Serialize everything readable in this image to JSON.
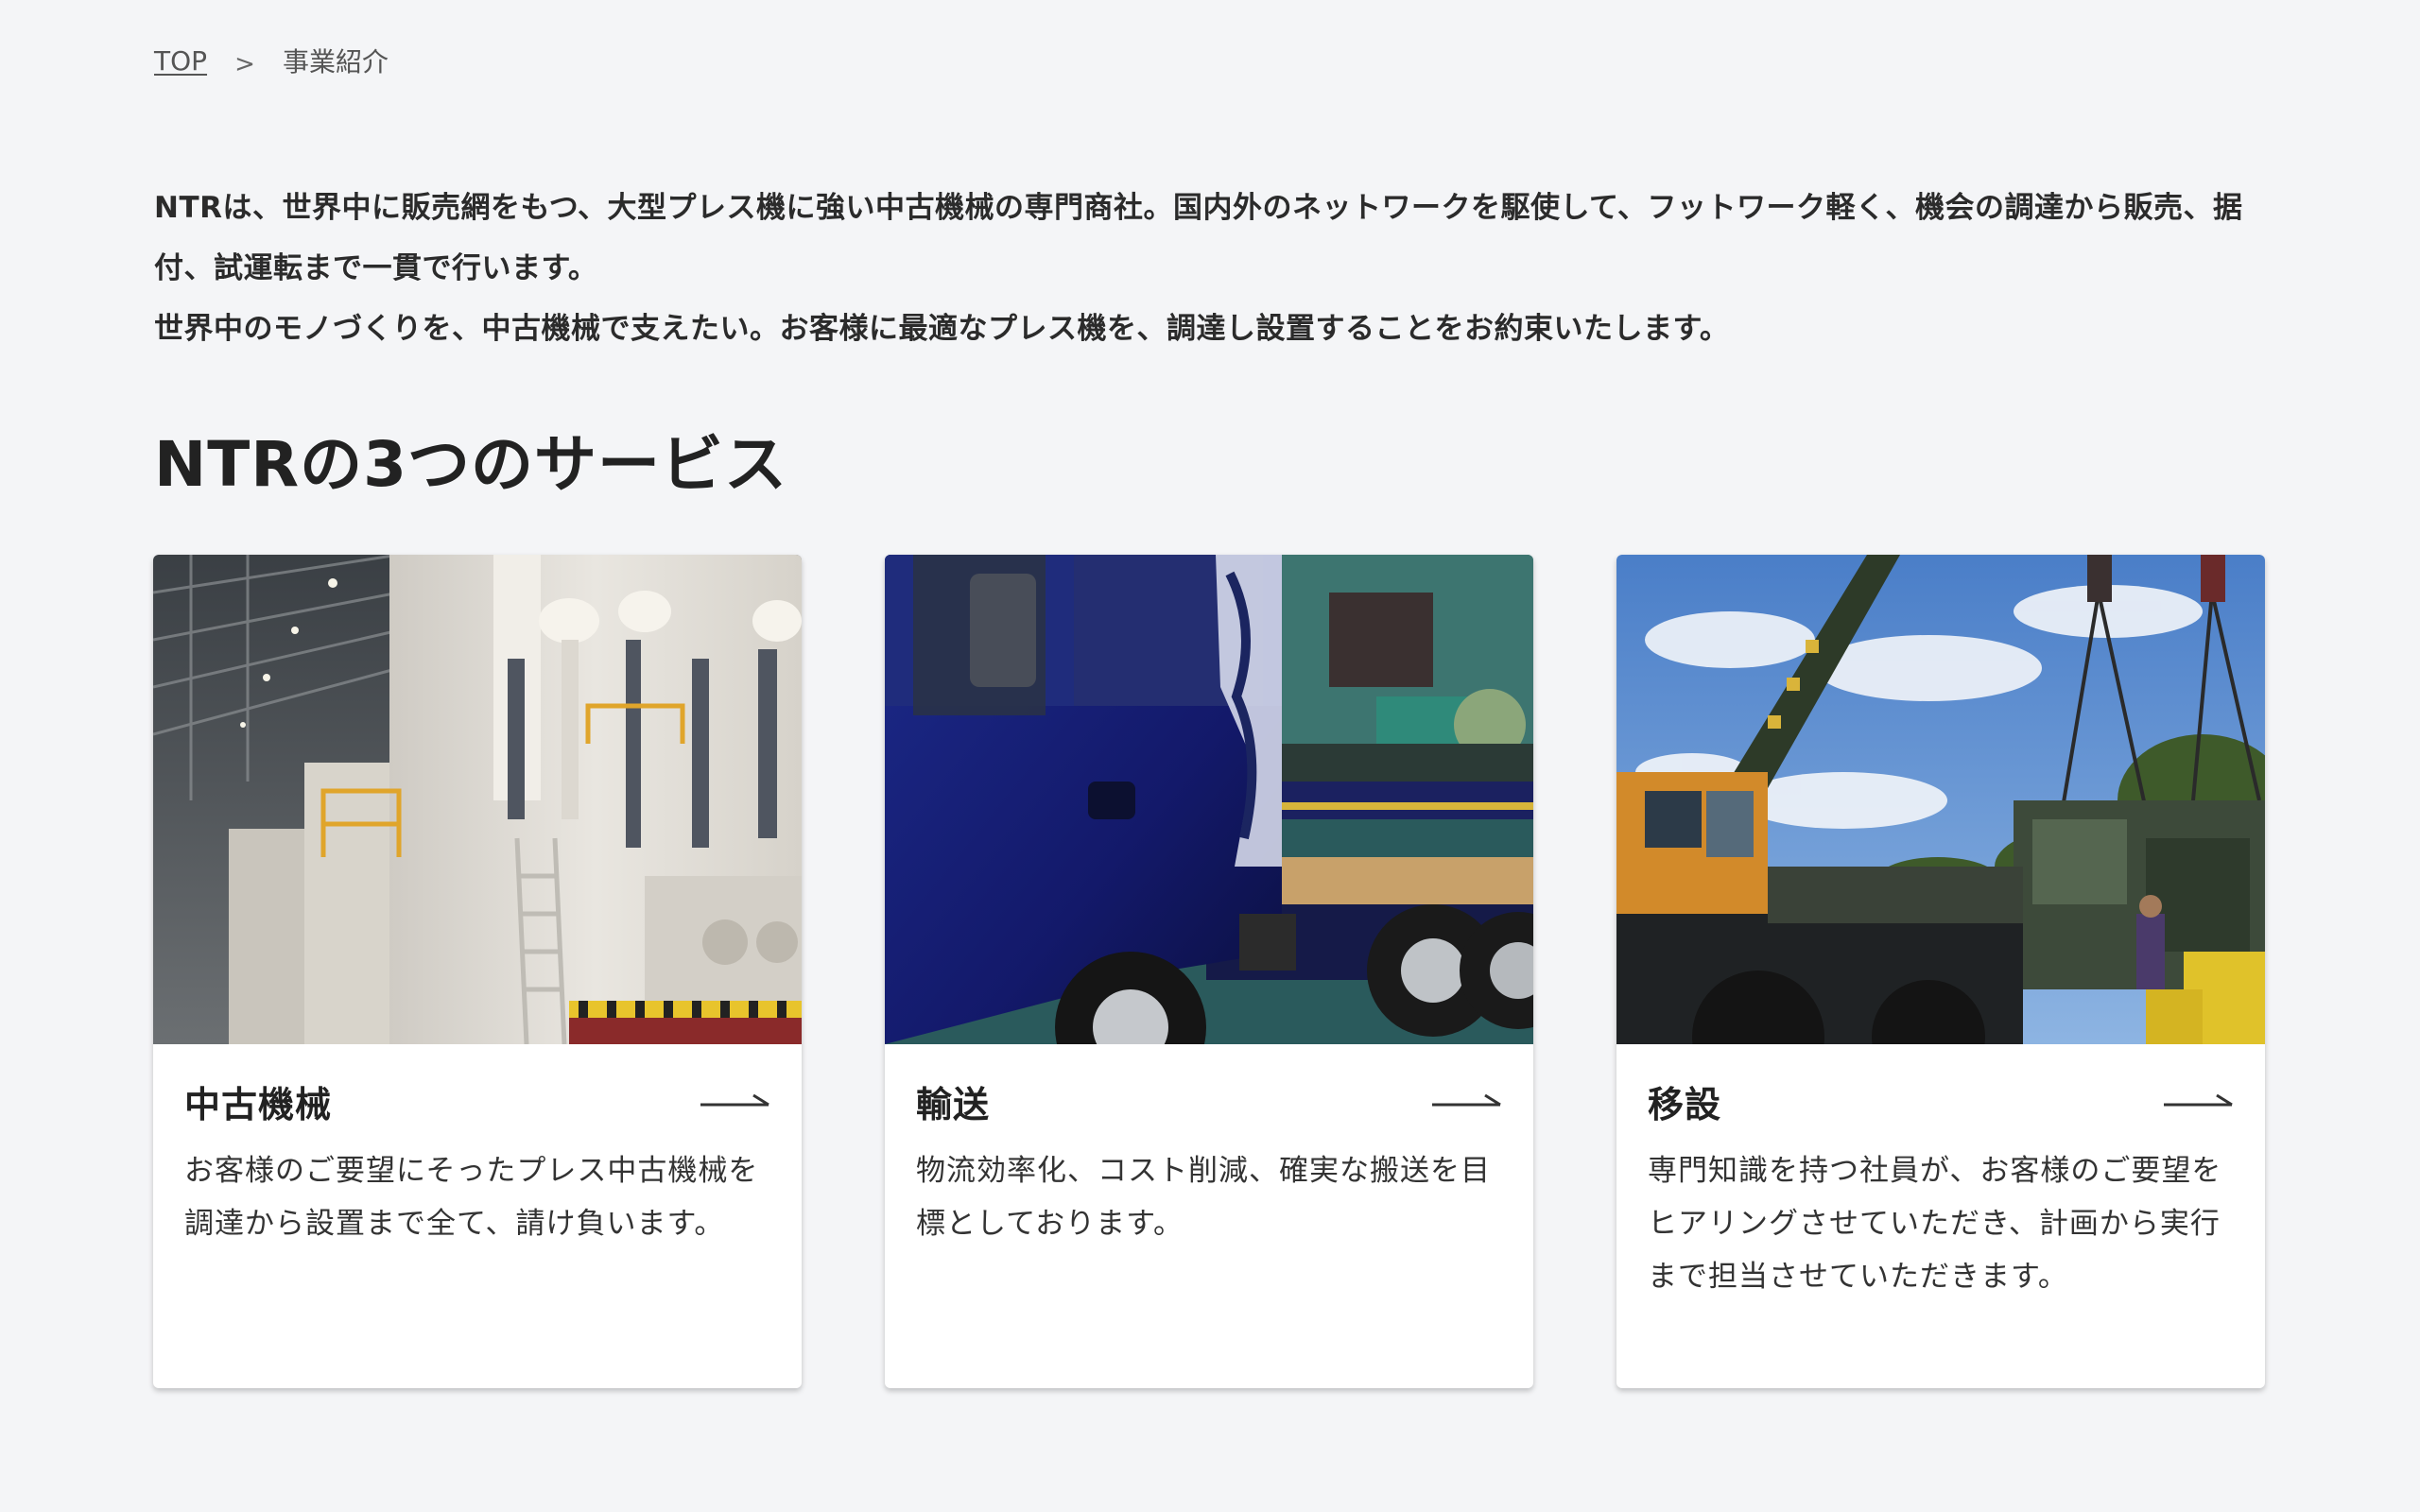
{
  "breadcrumb": {
    "home": "TOP",
    "separator": ">",
    "current": "事業紹介"
  },
  "intro": {
    "paragraph1": "NTRは、世界中に販売網をもつ、大型プレス機に強い中古機械の専門商社。国内外のネットワークを駆使して、フットワーク軽く、機会の調達から販売、据付、試運転まで一貫で行います。",
    "paragraph2": "世界中のモノづくりを、中古機械で支えたい。お客様に最適なプレス機を、調達し設置することをお約束いたします。"
  },
  "section": {
    "title": "NTRの3つのサービス"
  },
  "cards": [
    {
      "title": "中古機械",
      "description": "お客様のご要望にそったプレス中古機械を調達から設置まで全て、請け負います。",
      "image": "factory-press-machine-photo",
      "icon": "arrow-right-icon"
    },
    {
      "title": "輸送",
      "description": "物流効率化、コスト削減、確実な搬送を目標としております。",
      "image": "transport-truck-photo",
      "icon": "arrow-right-icon"
    },
    {
      "title": "移設",
      "description": "専門知識を持つ社員が、お客様のご要望をヒアリングさせていただき、計画から実行まで担当させていただきます。",
      "image": "crane-relocation-photo",
      "icon": "arrow-right-icon"
    }
  ],
  "colors": {
    "background": "#f4f5f7",
    "card_background": "#ffffff",
    "text": "#2a2a2a"
  }
}
